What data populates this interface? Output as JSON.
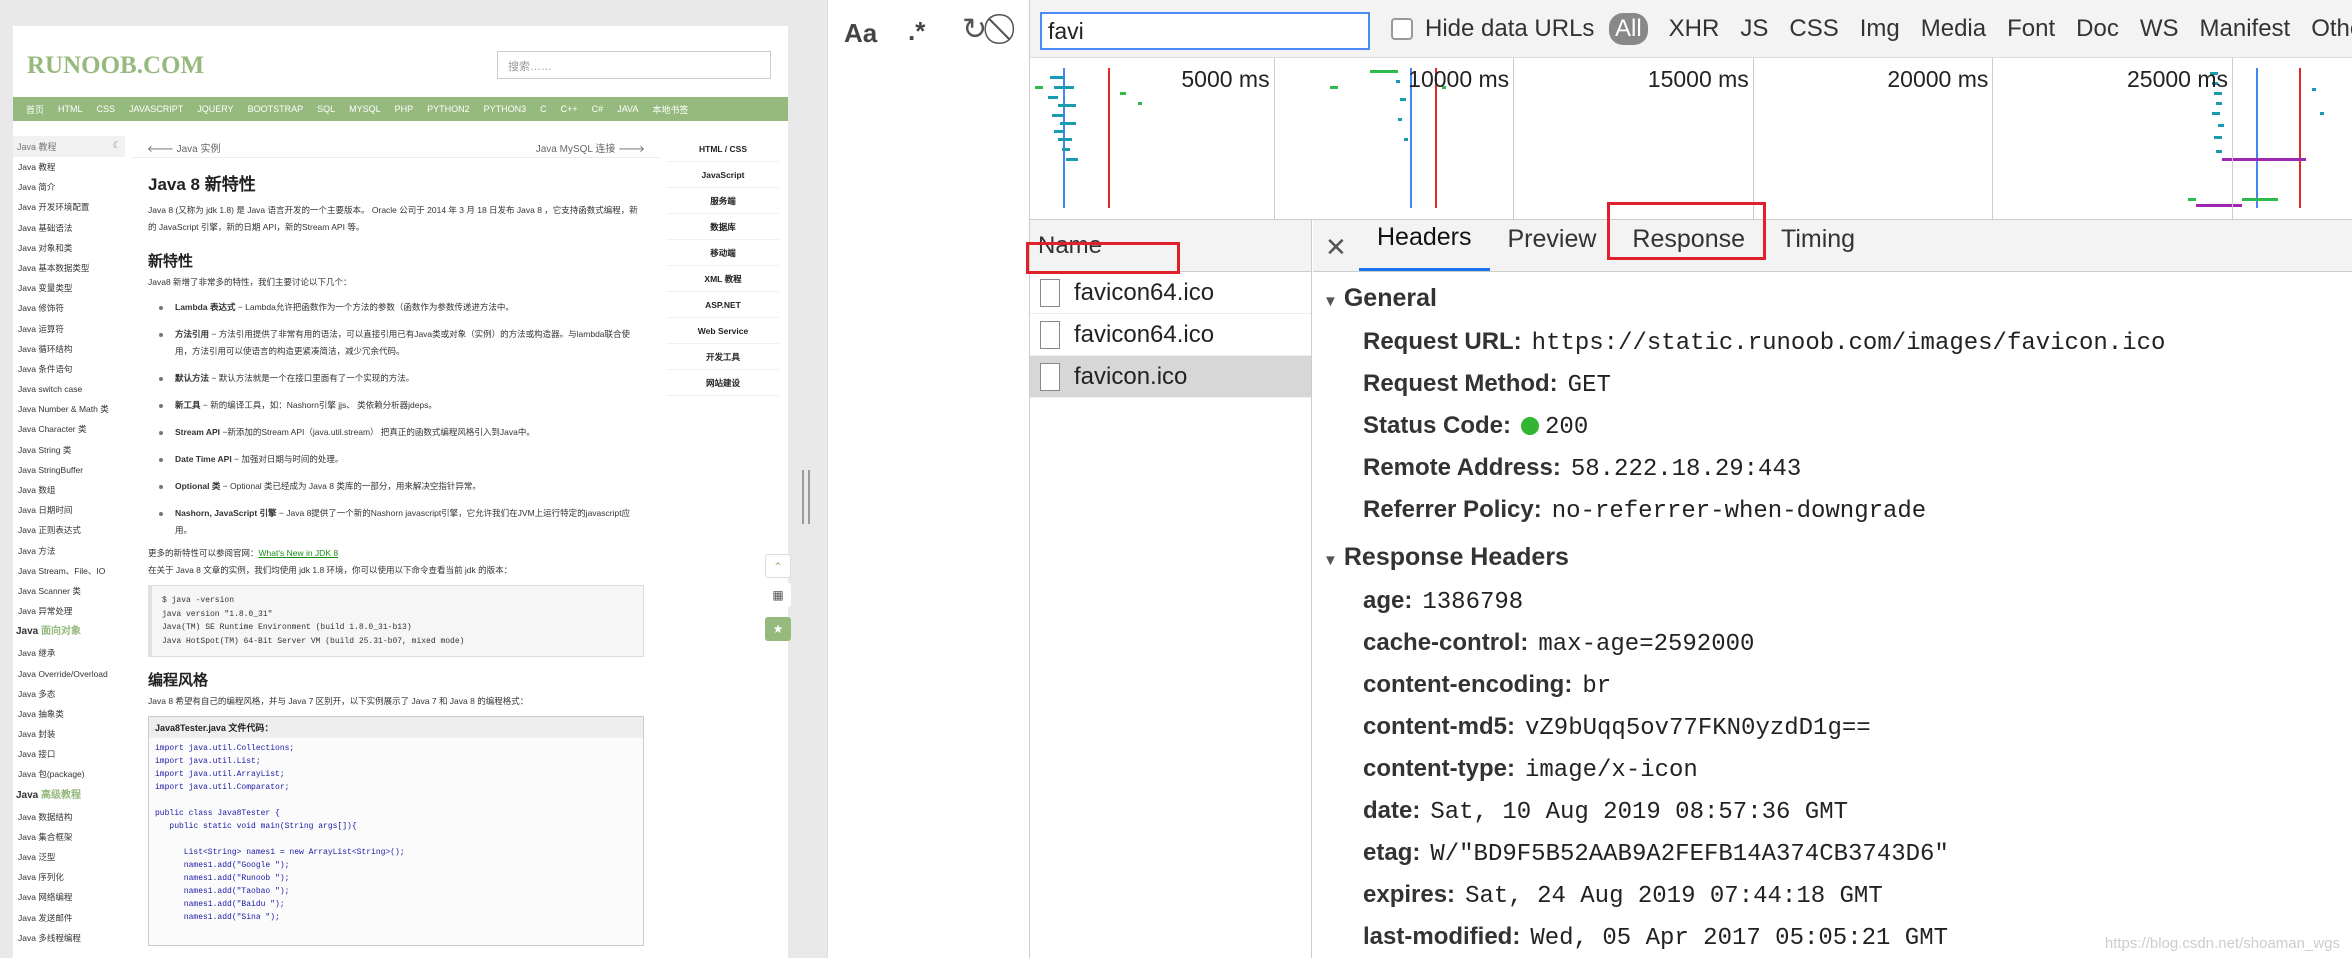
{
  "browser_page": {
    "logo": "RUNOOB.COM",
    "search_placeholder": "搜索……",
    "topnav": [
      "首页",
      "HTML",
      "CSS",
      "JAVASCRIPT",
      "JQUERY",
      "BOOTSTRAP",
      "SQL",
      "MYSQL",
      "PHP",
      "PYTHON2",
      "PYTHON3",
      "C",
      "C++",
      "C#",
      "JAVA",
      "本地书签"
    ],
    "sidebar_header": "Java 教程",
    "sidebar_items_1": [
      "Java 教程",
      "Java 简介",
      "Java 开发环境配置",
      "Java 基础语法",
      "Java 对象和类",
      "Java 基本数据类型",
      "Java 变量类型",
      "Java 修饰符",
      "Java 运算符",
      "Java 循环结构",
      "Java 条件语句",
      "Java switch case",
      "Java Number & Math 类",
      "Java Character 类",
      "Java String 类",
      "Java StringBuffer",
      "Java 数组",
      "Java 日期时间",
      "Java 正则表达式",
      "Java 方法",
      "Java Stream、File、IO",
      "Java Scanner 类",
      "Java 异常处理"
    ],
    "sidebar_section_2": {
      "prefix": "Java ",
      "highlight": "面向对象"
    },
    "sidebar_items_2": [
      "Java 继承",
      "Java Override/Overload",
      "Java 多态",
      "Java 抽象类",
      "Java 封装",
      "Java 接口",
      "Java 包(package)"
    ],
    "sidebar_section_3": {
      "prefix": "Java ",
      "highlight": "高级教程"
    },
    "sidebar_items_3": [
      "Java 数据结构",
      "Java 集合框架",
      "Java 泛型",
      "Java 序列化",
      "Java 网络编程",
      "Java 发送邮件",
      "Java 多线程编程"
    ],
    "prev_link": "Java 实例",
    "next_link": "Java MySQL 连接",
    "title": "Java 8 新特性",
    "intro": "Java 8 (又称为 jdk 1.8) 是 Java 语言开发的一个主要版本。 Oracle 公司于 2014 年 3 月 18 日发布 Java 8 ，它支持函数式编程，新的 JavaScript 引擎，新的日期 API，新的Stream API 等。",
    "h2_features": "新特性",
    "features_intro": "Java8 新增了非常多的特性，我们主要讨论以下几个：",
    "bullets": [
      {
        "b": "Lambda 表达式",
        "t": " − Lambda允许把函数作为一个方法的参数（函数作为参数传递进方法中。"
      },
      {
        "b": "方法引用",
        "t": " − 方法引用提供了非常有用的语法，可以直接引用已有Java类或对象（实例）的方法或构造器。与lambda联合使用，方法引用可以使语言的构造更紧凑简洁，减少冗余代码。"
      },
      {
        "b": "默认方法",
        "t": " − 默认方法就是一个在接口里面有了一个实现的方法。"
      },
      {
        "b": "新工具",
        "t": " − 新的编译工具，如：Nashorn引擎 jjs、 类依赖分析器jdeps。"
      },
      {
        "b": "Stream API",
        "t": " −新添加的Stream API（java.util.stream） 把真正的函数式编程风格引入到Java中。"
      },
      {
        "b": "Date Time API",
        "t": " − 加强对日期与时间的处理。"
      },
      {
        "b": "Optional 类",
        "t": " − Optional 类已经成为 Java 8 类库的一部分，用来解决空指针异常。"
      },
      {
        "b": "Nashorn, JavaScript 引擎",
        "t": " − Java 8提供了一个新的Nashorn javascript引擎，它允许我们在JVM上运行特定的javascript应用。"
      }
    ],
    "more_text": "更多的新特性可以参阅官网：",
    "more_link": "What's New in JDK 8",
    "env_text": "在关于 Java 8 文章的实例，我们均使用 jdk 1.8 环境，你可以使用以下命令查看当前 jdk 的版本：",
    "version_code": [
      "$ java -version",
      "java version \"1.8.0_31\"",
      "Java(TM) SE Runtime Environment (build 1.8.0_31-b13)",
      "Java HotSpot(TM) 64-Bit Server VM (build 25.31-b07, mixed mode)"
    ],
    "h2_style": "编程风格",
    "style_text": "Java 8 希望有自己的编程风格，并与 Java 7 区别开，以下实例展示了 Java 7 和 Java 8 的编程格式：",
    "java_file_label": "Java8Tester.java 文件代码：",
    "java_code": [
      "import java.util.Collections;",
      "import java.util.List;",
      "import java.util.ArrayList;",
      "import java.util.Comparator;",
      "",
      "public class Java8Tester {",
      "   public static void main(String args[]){",
      "",
      "      List<String> names1 = new ArrayList<String>();",
      "      names1.add(\"Google \");",
      "      names1.add(\"Runoob \");",
      "      names1.add(\"Taobao \");",
      "      names1.add(\"Baidu \");",
      "      names1.add(\"Sina \");"
    ],
    "right_nav": [
      "HTML / CSS",
      "JavaScript",
      "服务端",
      "数据库",
      "移动端",
      "XML 教程",
      "ASP.NET",
      "Web Service",
      "开发工具",
      "网站建设"
    ]
  },
  "devtools": {
    "toolbar": {
      "case_btn": "Aa",
      "regex_btn": ".*",
      "filter_value": "favi",
      "hide_data_urls": "Hide data URLs",
      "types": [
        "All",
        "XHR",
        "JS",
        "CSS",
        "Img",
        "Media",
        "Font",
        "Doc",
        "WS",
        "Manifest",
        "Other"
      ]
    },
    "timeline_ticks": [
      "5000 ms",
      "10000 ms",
      "15000 ms",
      "20000 ms",
      "25000 ms"
    ],
    "name_header": "Name",
    "requests": [
      "favicon64.ico",
      "favicon64.ico",
      "favicon.ico"
    ],
    "selected_request": 2,
    "tabs": [
      "Headers",
      "Preview",
      "Response",
      "Timing"
    ],
    "active_tab": "Headers",
    "general_title": "General",
    "general": [
      {
        "k": "Request URL:",
        "v": "https://static.runoob.com/images/favicon.ico"
      },
      {
        "k": "Request Method:",
        "v": "GET"
      },
      {
        "k": "Status Code:",
        "v": "200"
      },
      {
        "k": "Remote Address:",
        "v": "58.222.18.29:443"
      },
      {
        "k": "Referrer Policy:",
        "v": "no-referrer-when-downgrade"
      }
    ],
    "response_title": "Response Headers",
    "response_headers": [
      {
        "k": "age:",
        "v": "1386798"
      },
      {
        "k": "cache-control:",
        "v": "max-age=2592000"
      },
      {
        "k": "content-encoding:",
        "v": "br"
      },
      {
        "k": "content-md5:",
        "v": "vZ9bUqq5ov77FKN0yzdD1g=="
      },
      {
        "k": "content-type:",
        "v": "image/x-icon"
      },
      {
        "k": "date:",
        "v": "Sat, 10 Aug 2019 08:57:36 GMT"
      },
      {
        "k": "etag:",
        "v": "W/\"BD9F5B52AAB9A2FEFB14A374CB3743D6\""
      },
      {
        "k": "expires:",
        "v": "Sat, 24 Aug 2019 07:44:18 GMT"
      },
      {
        "k": "last-modified:",
        "v": "Wed, 05 Apr 2017 05:05:21 GMT"
      }
    ],
    "status_color": "#32b632",
    "highlight_color": "#e0202a"
  },
  "watermark": "https://blog.csdn.net/shoaman_wgs"
}
